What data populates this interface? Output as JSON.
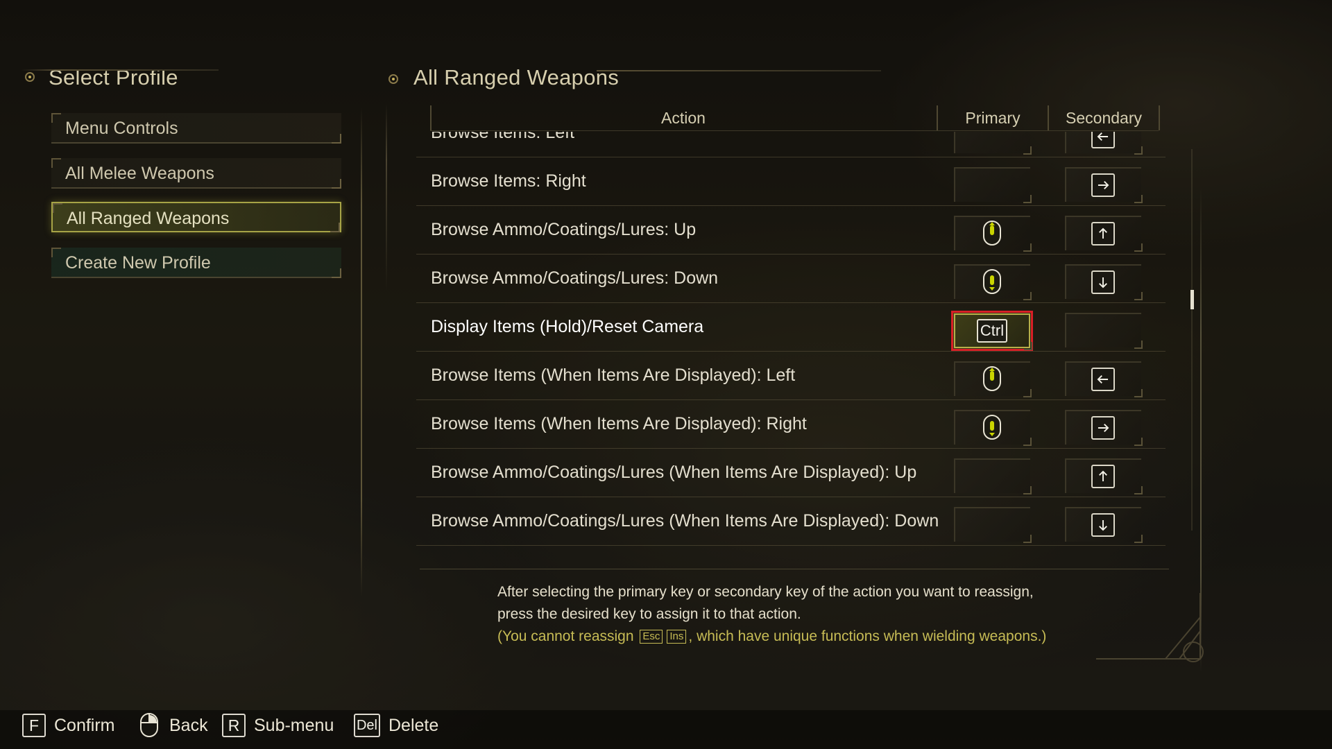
{
  "left_panel": {
    "title": "Select Profile",
    "items": [
      {
        "label": "Menu Controls"
      },
      {
        "label": "All Melee Weapons"
      },
      {
        "label": "All Ranged Weapons"
      },
      {
        "label": "Create New Profile"
      }
    ]
  },
  "main": {
    "title": "All Ranged Weapons",
    "columns": {
      "action": "Action",
      "primary": "Primary",
      "secondary": "Secondary"
    },
    "rows": [
      {
        "action": "Browse Items: Left",
        "primary": "",
        "secondary": "arrow-left-icon"
      },
      {
        "action": "Browse Items: Right",
        "primary": "",
        "secondary": "arrow-right-icon"
      },
      {
        "action": "Browse Ammo/Coatings/Lures: Up",
        "primary": "mouse-wheel-up-icon",
        "secondary": "arrow-up-icon"
      },
      {
        "action": "Browse Ammo/Coatings/Lures: Down",
        "primary": "mouse-wheel-down-icon",
        "secondary": "arrow-down-icon"
      },
      {
        "action": "Display Items (Hold)/Reset Camera",
        "primary": "Ctrl",
        "secondary": ""
      },
      {
        "action": "Browse Items (When Items Are Displayed): Left",
        "primary": "mouse-wheel-up-icon",
        "secondary": "arrow-left-icon"
      },
      {
        "action": "Browse Items (When Items Are Displayed): Right",
        "primary": "mouse-wheel-down-icon",
        "secondary": "arrow-right-icon"
      },
      {
        "action": "Browse Ammo/Coatings/Lures (When Items Are Displayed): Up",
        "primary": "",
        "secondary": "arrow-up-icon"
      },
      {
        "action": "Browse Ammo/Coatings/Lures (When Items Are Displayed): Down",
        "primary": "",
        "secondary": "arrow-down-icon"
      }
    ],
    "notes": {
      "line1": "After selecting the primary key or secondary key of the action you want to reassign,",
      "line2": "press the desired key to assign it to that action.",
      "warn_prefix": "(You cannot reassign",
      "key_esc": "Esc",
      "key_ins": "Ins",
      "warn_suffix": ", which have unique functions when wielding weapons.)"
    }
  },
  "footer": {
    "hints": [
      {
        "key": "F",
        "label": "Confirm"
      },
      {
        "key": "mouse-right-icon",
        "label": "Back"
      },
      {
        "key": "R",
        "label": "Sub-menu"
      },
      {
        "key": "Del",
        "label": "Delete"
      }
    ]
  },
  "colors": {
    "accent": "#a7a446",
    "selection_outline": "#d81f26",
    "warning_text": "#c7bc55"
  }
}
